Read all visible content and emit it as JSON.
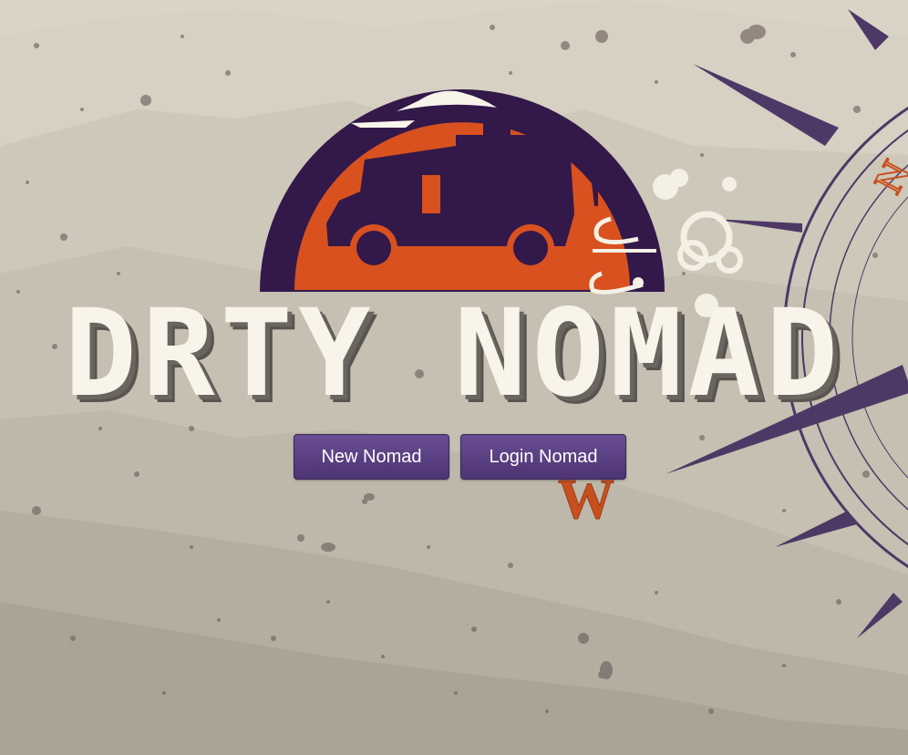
{
  "brand": {
    "title": "DRTY NOMAD",
    "logo_icon": "van-sunset-logo-icon",
    "compass_icon": "compass-rose-icon",
    "compass_letters": {
      "north_fragment": "N",
      "west": "W"
    }
  },
  "actions": {
    "new_label": "New Nomad",
    "login_label": "Login Nomad"
  },
  "colors": {
    "background": "#d9d4c6",
    "purple": "#33184a",
    "orange": "#d8511f",
    "cream": "#f8f4ea",
    "button": "#5b3f84"
  }
}
